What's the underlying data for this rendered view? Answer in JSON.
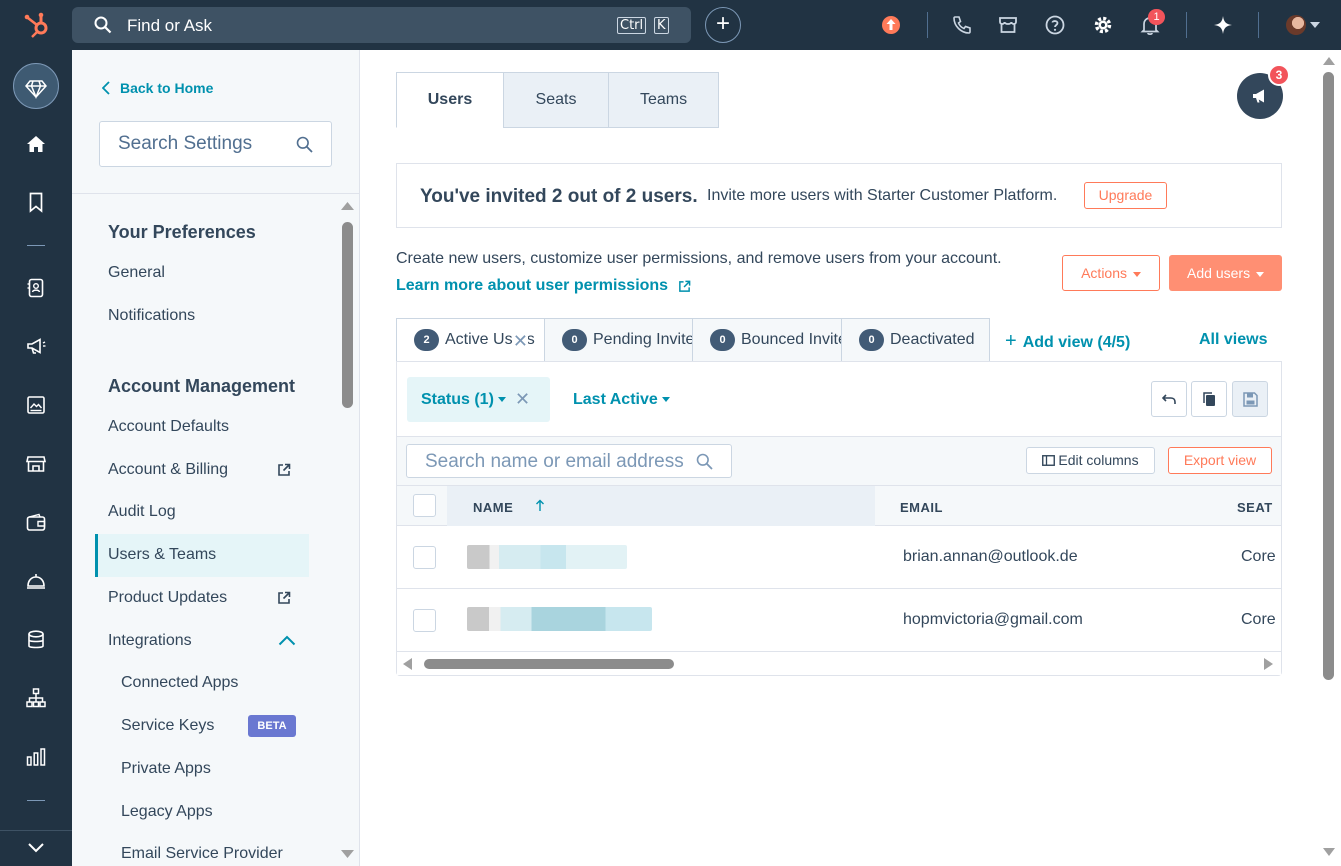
{
  "topbar": {
    "search_text": "Find or Ask",
    "kbd_ctrl": "Ctrl",
    "kbd_k": "K",
    "notification_count": "1"
  },
  "sidebar": {
    "back_label": "Back to Home",
    "search_placeholder": "Search Settings",
    "sections": {
      "preferences": "Your Preferences",
      "account": "Account Management"
    },
    "items": {
      "general": "General",
      "notifications": "Notifications",
      "account_defaults": "Account Defaults",
      "account_billing": "Account & Billing",
      "audit_log": "Audit Log",
      "users_teams": "Users & Teams",
      "product_updates": "Product Updates",
      "integrations": "Integrations",
      "connected_apps": "Connected Apps",
      "service_keys": "Service Keys",
      "private_apps": "Private Apps",
      "legacy_apps": "Legacy Apps",
      "email_service_provider": "Email Service Provider"
    },
    "beta_badge": "BETA"
  },
  "main": {
    "tabs": [
      "Users",
      "Seats",
      "Teams"
    ],
    "announcement_count": "3",
    "invite": {
      "strong": "You've invited 2 out of 2 users.",
      "light": "Invite more users with Starter Customer Platform.",
      "upgrade": "Upgrade"
    },
    "description": "Create new users, customize user permissions, and remove users from your account.",
    "learn_more": "Learn more about user permissions",
    "actions_label": "Actions",
    "add_users_label": "Add users",
    "views": [
      {
        "count": "2",
        "label": "Active Users"
      },
      {
        "count": "0",
        "label": "Pending Invites"
      },
      {
        "count": "0",
        "label": "Bounced Invites"
      },
      {
        "count": "0",
        "label": "Deactivated"
      }
    ],
    "add_view": "Add view (4/5)",
    "all_views": "All views",
    "filters": {
      "status": "Status (1)",
      "last_active": "Last Active"
    },
    "table_search_placeholder": "Search name or email address",
    "edit_columns": "Edit columns",
    "export_view": "Export view",
    "columns": {
      "name": "NAME",
      "email": "EMAIL",
      "seat": "SEAT"
    },
    "rows": [
      {
        "email": "brian.annan@outlook.de",
        "seat": "Core"
      },
      {
        "email": "hopmvictoria@gmail.com",
        "seat": "Core"
      }
    ]
  },
  "colors": {
    "nav_bg": "#213343",
    "accent": "#0091ae",
    "cta": "#ff7a59",
    "badge": "#f2545b"
  }
}
